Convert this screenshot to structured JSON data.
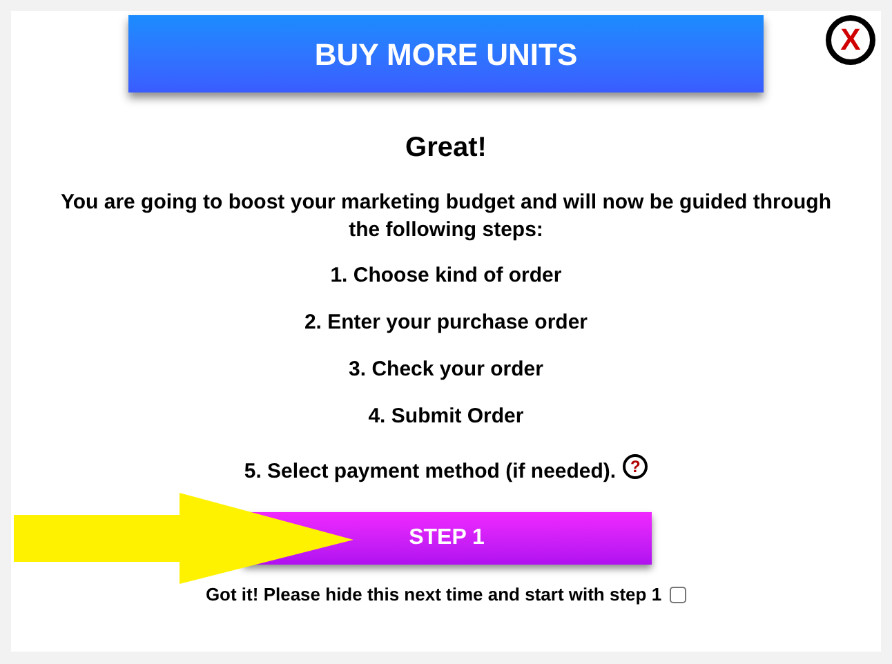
{
  "header": {
    "title": "BUY MORE UNITS"
  },
  "close": {
    "label": "X"
  },
  "heading": "Great!",
  "intro": "You are going to boost your marketing budget and will now be guided through the following steps:",
  "steps": [
    {
      "text": "1. Choose kind of order"
    },
    {
      "text": "2. Enter your purchase order"
    },
    {
      "text": "3. Check your order"
    },
    {
      "text": "4. Submit Order"
    },
    {
      "text": "5. Select payment method (if needed).",
      "help": "?"
    }
  ],
  "step_button": "STEP 1",
  "hide_option": {
    "label": "Got it! Please hide this next time and start with step 1",
    "checked": false
  }
}
